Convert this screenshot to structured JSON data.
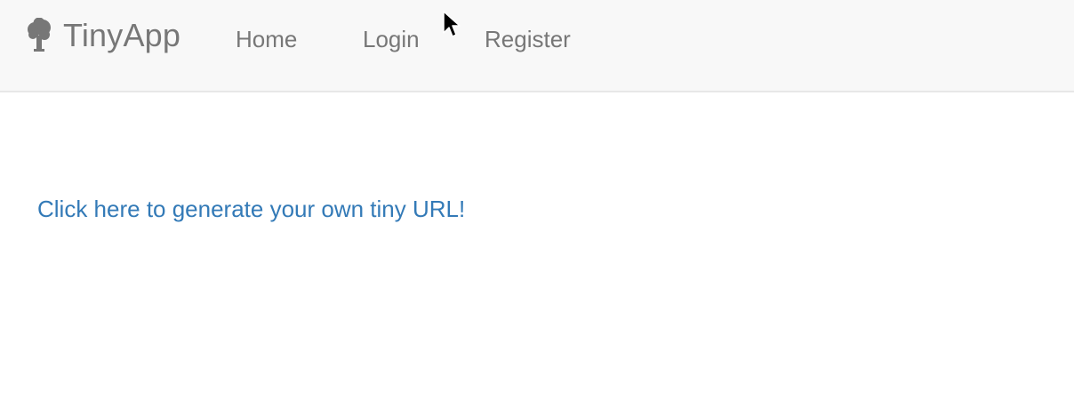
{
  "navbar": {
    "brand": {
      "icon": "tree-icon",
      "label": "TinyApp"
    },
    "links": [
      {
        "label": "Home"
      },
      {
        "label": "Login"
      },
      {
        "label": "Register"
      }
    ]
  },
  "main": {
    "cta_label": "Click here to generate your own tiny URL!"
  },
  "colors": {
    "navbar_bg": "#f8f8f8",
    "nav_text": "#777777",
    "link": "#337ab7"
  },
  "cursor": {
    "icon": "mouse-pointer-icon"
  }
}
